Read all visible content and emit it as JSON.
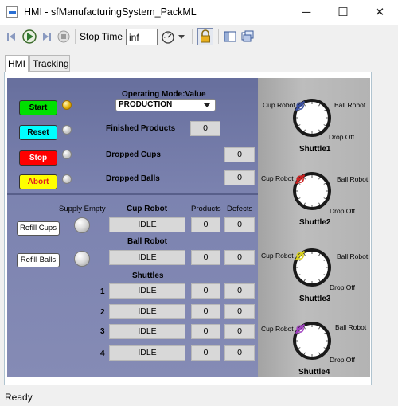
{
  "window": {
    "title": "HMI - sfManufacturingSystem_PackML",
    "minimize_icon": "─",
    "maximize_icon": "☐",
    "close_icon": "✕"
  },
  "toolbar": {
    "stop_time_label": "Stop Time",
    "stop_time_value": "inf"
  },
  "tabs": [
    {
      "label": "HMI",
      "active": true
    },
    {
      "label": "Tracking",
      "active": false
    }
  ],
  "controls": {
    "start_label": "Start",
    "reset_label": "Reset",
    "stop_label": "Stop",
    "abort_label": "Abort",
    "start_color": "#00e000",
    "reset_color": "#00ffff",
    "stop_color": "#ff0000",
    "abort_color": "#ffff00"
  },
  "operating_mode": {
    "label": "Operating Mode:Value",
    "value": "PRODUCTION"
  },
  "counters": {
    "finished_products_label": "Finished Products",
    "finished_products": "0",
    "dropped_cups_label": "Dropped Cups",
    "dropped_cups": "0",
    "dropped_balls_label": "Dropped Balls",
    "dropped_balls": "0"
  },
  "supply": {
    "supply_empty_label": "Supply Empty",
    "refill_cups_label": "Refill Cups",
    "refill_balls_label": "Refill Balls"
  },
  "table": {
    "products_header": "Products",
    "defects_header": "Defects",
    "cup_robot_header": "Cup Robot",
    "cup_robot_state": "IDLE",
    "cup_robot_products": "0",
    "cup_robot_defects": "0",
    "ball_robot_header": "Ball Robot",
    "ball_robot_state": "IDLE",
    "ball_robot_products": "0",
    "ball_robot_defects": "0",
    "shuttles_header": "Shuttles",
    "shuttles": [
      {
        "index": "1",
        "state": "IDLE",
        "products": "0",
        "defects": "0"
      },
      {
        "index": "2",
        "state": "IDLE",
        "products": "0",
        "defects": "0"
      },
      {
        "index": "3",
        "state": "IDLE",
        "products": "0",
        "defects": "0"
      },
      {
        "index": "4",
        "state": "IDLE",
        "products": "0",
        "defects": "0"
      }
    ]
  },
  "gauges": [
    {
      "name": "Shuttle1",
      "cup": "Cup Robot",
      "ball": "Ball Robot",
      "drop": "Drop Off",
      "marker_color": "#3a4fa0",
      "marker_position": "drop-off"
    },
    {
      "name": "Shuttle2",
      "cup": "Cup Robot",
      "ball": "Ball Robot",
      "drop": "Drop Off",
      "marker_color": "#cc2020",
      "marker_position": "drop-off"
    },
    {
      "name": "Shuttle3",
      "cup": "Cup Robot",
      "ball": "Ball Robot",
      "drop": "Drop Off",
      "marker_color": "#d8d020",
      "marker_position": "drop-off"
    },
    {
      "name": "Shuttle4",
      "cup": "Cup Robot",
      "ball": "Ball Robot",
      "drop": "Drop Off",
      "marker_color": "#a040c0",
      "marker_position": "drop-off"
    }
  ],
  "status": "Ready"
}
